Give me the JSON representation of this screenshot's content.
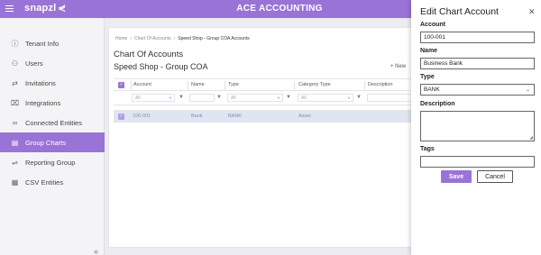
{
  "topbar": {
    "logo": "snapzl",
    "logo_mark": "⋞",
    "app_title": "ACE ACCOUNTING"
  },
  "sidebar": {
    "items": [
      {
        "label": "Tenant Info",
        "icon": "info-icon"
      },
      {
        "label": "Users",
        "icon": "users-icon"
      },
      {
        "label": "Invitations",
        "icon": "invitations-icon"
      },
      {
        "label": "Integrations",
        "icon": "integrations-icon"
      },
      {
        "label": "Connected Entities",
        "icon": "link-icon"
      },
      {
        "label": "Group Charts",
        "icon": "chart-list-icon",
        "active": true
      },
      {
        "label": "Reporting Group",
        "icon": "reporting-icon"
      },
      {
        "label": "CSV Entities",
        "icon": "csv-icon"
      }
    ],
    "collapse": "«"
  },
  "main": {
    "breadcrumbs": [
      "Home",
      "Chart Of Accounts",
      "Speed Shop - Group COA Accounts"
    ],
    "title": "Chart Of Accounts",
    "subtitle": "Speed Shop - Group COA",
    "new_label": "+ New",
    "columns": [
      "Account",
      "Name",
      "Type",
      "Category Type",
      "Description"
    ],
    "filter_all": "All",
    "rows": [
      {
        "account": "100-001",
        "name": "Bank",
        "type": "BANK",
        "category": "Asset",
        "description": ""
      }
    ]
  },
  "panel": {
    "title": "Edit Chart Account",
    "account_label": "Account",
    "account_value": "100-001",
    "name_label": "Name",
    "name_value": "Business Bank",
    "type_label": "Type",
    "type_value": "BANK",
    "description_label": "Description",
    "description_value": "",
    "tags_label": "Tags",
    "tags_value": "",
    "save": "Save",
    "cancel": "Cancel"
  },
  "colors": {
    "accent": "#9a73d6",
    "row_selected": "#dfe6f2"
  }
}
